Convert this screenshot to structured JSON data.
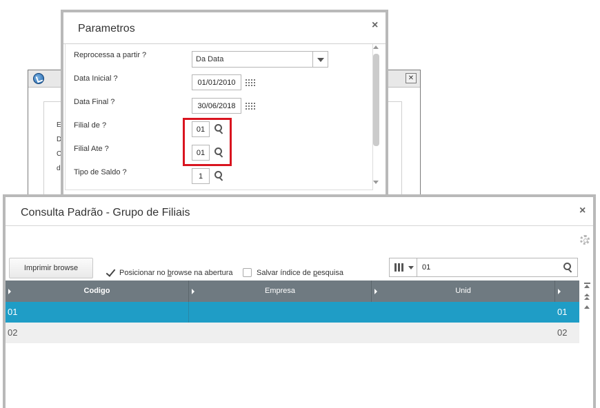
{
  "background_window": {
    "close_label": "✕",
    "letters": [
      "E",
      "D",
      "C",
      "d"
    ]
  },
  "parametros": {
    "title": "Parametros",
    "close_label": "×",
    "fields": {
      "reprocessa": {
        "label": "Reprocessa a partir ?",
        "value": "Da Data"
      },
      "data_inicial": {
        "label": "Data Inicial ?",
        "value": "01/01/2010"
      },
      "data_final": {
        "label": "Data Final ?",
        "value": "30/06/2018"
      },
      "filial_de": {
        "label": "Filial de ?",
        "value": "01"
      },
      "filial_ate": {
        "label": "Filial Ate ?",
        "value": "01"
      },
      "tipo_saldo": {
        "label": "Tipo de Saldo ?",
        "value": "1"
      }
    },
    "highlight_color": "#d9141f"
  },
  "consulta": {
    "title": "Consulta Padrão - Grupo de Filiais",
    "close_label": "×",
    "print_button": "Imprimir browse",
    "options": {
      "posicionar": {
        "pre": "Posicionar no ",
        "underlined": "b",
        "post": "rowse na abertura",
        "checked": true
      },
      "salvar": {
        "pre": "Salvar índice de ",
        "underlined": "p",
        "post": "esquisa",
        "checked": false
      }
    },
    "search_value": "01",
    "columns": [
      "Codigo",
      "Empresa",
      "Unid"
    ],
    "rows": [
      {
        "codigo": "01",
        "empresa": "",
        "unid": "01",
        "selected": true
      },
      {
        "codigo": "02",
        "empresa": "",
        "unid": "02",
        "selected": false
      }
    ],
    "selected_color": "#1f9dc6",
    "header_color": "#6f7a81"
  }
}
